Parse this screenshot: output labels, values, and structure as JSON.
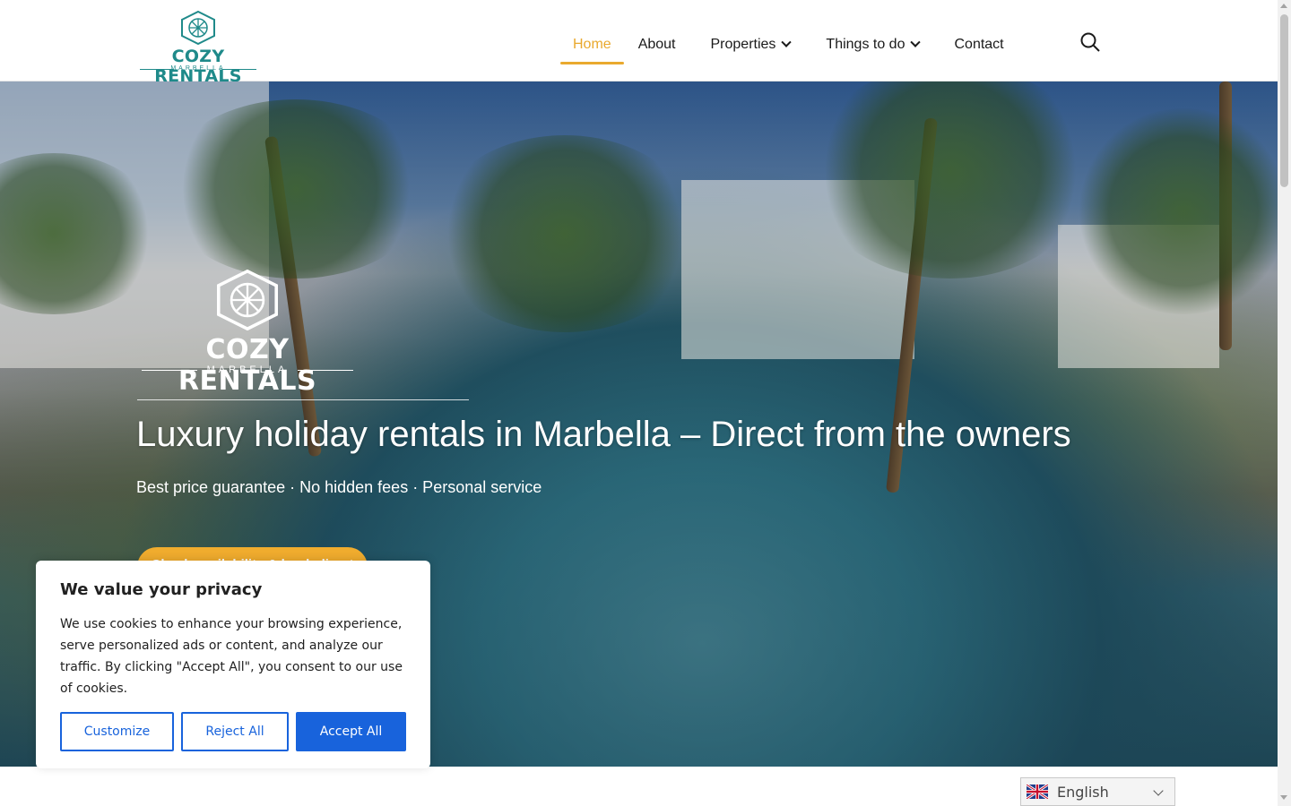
{
  "header": {
    "logo_text": "COZY RENTALS",
    "logo_subtext": "MARBELLA",
    "nav": [
      {
        "label": "Home",
        "active": true,
        "has_dropdown": false
      },
      {
        "label": "About",
        "active": false,
        "has_dropdown": false
      },
      {
        "label": "Properties",
        "active": false,
        "has_dropdown": true
      },
      {
        "label": "Things to do",
        "active": false,
        "has_dropdown": true
      },
      {
        "label": "Contact",
        "active": false,
        "has_dropdown": false
      }
    ],
    "search_icon": "search-icon",
    "dropdown_icon": "chevron-down-icon"
  },
  "hero": {
    "logo_text": "COZY RENTALS",
    "logo_subtext": "MARBELLA",
    "title": "Luxury holiday rentals in Marbella – Direct from the owners",
    "subtitle": "Best price guarantee · No hidden fees · Personal service",
    "cta_label": "Check availability & book direct"
  },
  "cookie_banner": {
    "title": "We value your privacy",
    "body": "We use cookies to enhance your browsing experience, serve personalized ads or content, and analyze our traffic. By clicking \"Accept All\", you consent to our use of cookies.",
    "customize_label": "Customize",
    "reject_label": "Reject All",
    "accept_label": "Accept All"
  },
  "language_selector": {
    "selected": "English",
    "flag_icon": "uk-flag-icon"
  },
  "colors": {
    "accent": "#e9a92e",
    "brand_teal": "#1f8a8a",
    "cookie_blue": "#1863dc",
    "cta": "#f0ac2e"
  }
}
